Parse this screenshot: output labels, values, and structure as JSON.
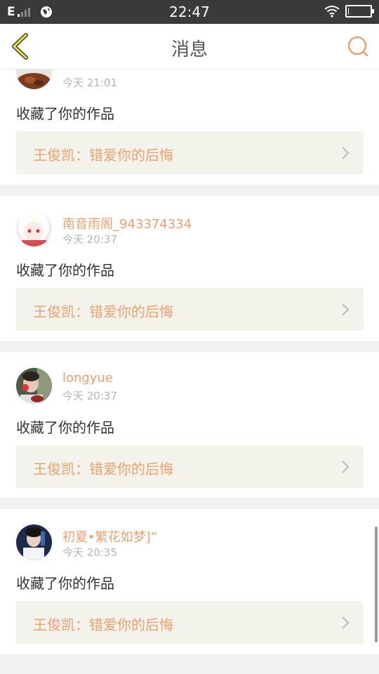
{
  "status_bar": {
    "network_type": "E",
    "time": "22:47",
    "icons": [
      "signal-icon",
      "globe-icon",
      "wifi-icon",
      "battery-icon"
    ]
  },
  "header": {
    "title": "消息",
    "back_icon": "chevron-left-icon",
    "search_icon": "search-icon",
    "accent_color": "#e8a16f"
  },
  "messages": [
    {
      "username": "",
      "time": "今天 21:01",
      "action": "收藏了你的作品",
      "work_title": "王俊凯：错爱你的后悔"
    },
    {
      "username": "南音雨阁_943374334",
      "time": "今天 20:37",
      "action": "收藏了你的作品",
      "work_title": "王俊凯：错爱你的后悔"
    },
    {
      "username": "longyue",
      "time": "今天 20:37",
      "action": "收藏了你的作品",
      "work_title": "王俊凯：错爱你的后悔"
    },
    {
      "username": "初夏•繁花如梦]”",
      "time": "今天 20:35",
      "action": "收藏了你的作品",
      "work_title": "王俊凯：错爱你的后悔"
    }
  ]
}
